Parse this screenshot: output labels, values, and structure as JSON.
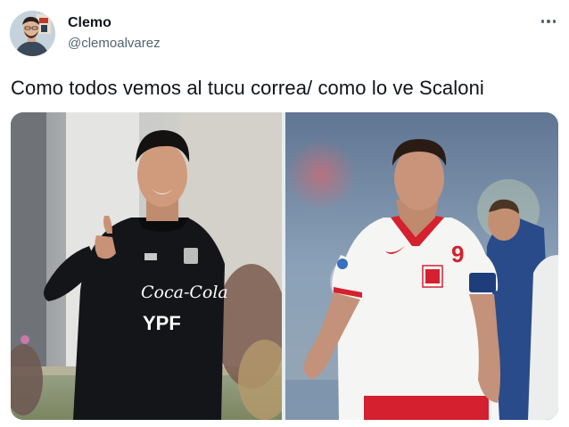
{
  "author": {
    "name": "Clemo",
    "handle": "@clemoalvarez"
  },
  "tweet": {
    "text": "Como todos vemos al tucu correa/ como lo ve Scaloni"
  },
  "media": {
    "left_photo": {
      "shirt_sponsor": "Coca-Cola",
      "shirt_sponsor_secondary": "YPF"
    },
    "right_photo": {
      "shirt_number": "9"
    }
  },
  "icons": {
    "more": "more-options-icon"
  },
  "colors": {
    "text_primary": "#0f1419",
    "text_secondary": "#536471",
    "poland_red": "#d4202f"
  }
}
